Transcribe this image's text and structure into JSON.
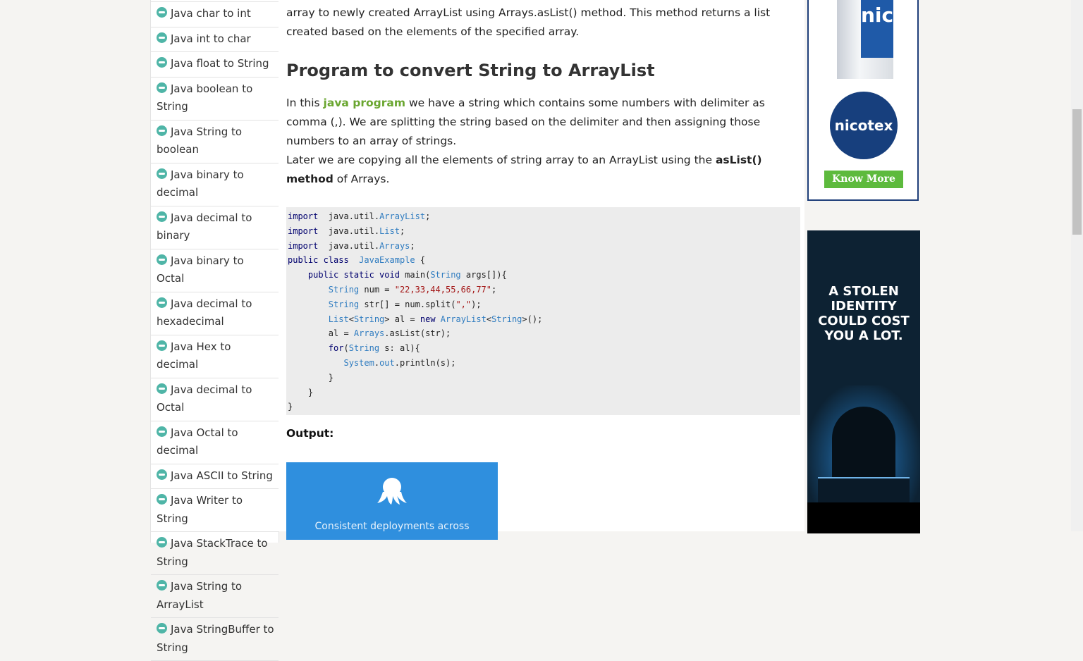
{
  "sidebar": {
    "items": [
      "Java char to int",
      "Java int to char",
      "Java float to String",
      "Java boolean to String",
      "Java String to boolean",
      "Java binary to decimal",
      "Java decimal to binary",
      "Java binary to Octal",
      "Java decimal to hexadecimal",
      "Java Hex to decimal",
      "Java decimal to Octal",
      "Java Octal to decimal",
      "Java ASCII to String",
      "Java Writer to String",
      "Java StackTrace to String",
      "Java String to ArrayList",
      "Java StringBuffer to String"
    ]
  },
  "article": {
    "intro": "array to newly created ArrayList using Arrays.asList() method. This method returns a list created based on the elements of the specified array.",
    "heading": "Program to convert String to ArrayList",
    "p1_before": "In this ",
    "p1_link": "java program",
    "p1_after": " we have a string which contains some numbers with delimiter as comma (,). We are splitting the string based on the delimiter and then assigning those numbers to an array of strings.",
    "p2_before": "Later we are copying all the elements of string array to an ArrayList using the ",
    "p2_bold": "asList() method",
    "p2_after": " of Arrays.",
    "output_label": "Output:",
    "output_caption": "Consistent deployments across"
  },
  "code": [
    [
      [
        "kw",
        "import"
      ],
      [
        "",
        "  java.util."
      ],
      [
        "ty",
        "ArrayList"
      ],
      [
        "",
        ";"
      ]
    ],
    [
      [
        "kw",
        "import"
      ],
      [
        "",
        "  java.util."
      ],
      [
        "ty",
        "List"
      ],
      [
        "",
        ";"
      ]
    ],
    [
      [
        "kw",
        "import"
      ],
      [
        "",
        "  java.util."
      ],
      [
        "ty",
        "Arrays"
      ],
      [
        "",
        ";"
      ]
    ],
    [
      [
        "kw",
        "public class"
      ],
      [
        "",
        "  "
      ],
      [
        "ty",
        "JavaExample"
      ],
      [
        "",
        " {"
      ]
    ],
    [
      [
        "",
        "    "
      ],
      [
        "kw",
        "public static void"
      ],
      [
        "",
        " main("
      ],
      [
        "ty",
        "String"
      ],
      [
        "",
        " args[]){"
      ]
    ],
    [
      [
        "",
        "        "
      ],
      [
        "ty",
        "String"
      ],
      [
        "",
        " num = "
      ],
      [
        "st",
        "\"22,33,44,55,66,77\""
      ],
      [
        "",
        ";"
      ]
    ],
    [
      [
        "",
        "        "
      ],
      [
        "ty",
        "String"
      ],
      [
        "",
        " str[] = num.split("
      ],
      [
        "st",
        "\",\""
      ],
      [
        "",
        ");"
      ]
    ],
    [
      [
        "",
        "        "
      ],
      [
        "ty",
        "List"
      ],
      [
        "",
        "<"
      ],
      [
        "ty",
        "String"
      ],
      [
        "",
        "> al = "
      ],
      [
        "kw",
        "new"
      ],
      [
        "",
        " "
      ],
      [
        "ty",
        "ArrayList"
      ],
      [
        "",
        "<"
      ],
      [
        "ty",
        "String"
      ],
      [
        "",
        ">();"
      ]
    ],
    [
      [
        "",
        "        al = "
      ],
      [
        "ty",
        "Arrays"
      ],
      [
        "",
        ".asList(str);"
      ]
    ],
    [
      [
        "",
        "        "
      ],
      [
        "kw",
        "for"
      ],
      [
        "",
        "("
      ],
      [
        "ty",
        "String"
      ],
      [
        "",
        " s: al){"
      ]
    ],
    [
      [
        "",
        "           "
      ],
      [
        "ty",
        "System"
      ],
      [
        "",
        "."
      ],
      [
        "ty",
        "out"
      ],
      [
        "",
        ".println(s);"
      ]
    ],
    [
      [
        "",
        "        }"
      ]
    ],
    [
      [
        "",
        "    }"
      ]
    ],
    [
      [
        "",
        "}"
      ]
    ]
  ],
  "ads": {
    "ad1_logo": "nicotex",
    "ad1_button": "Know More",
    "ad1_pack_text": "nic",
    "ad2_text": "A STOLEN IDENTITY COULD COST YOU A LOT."
  }
}
